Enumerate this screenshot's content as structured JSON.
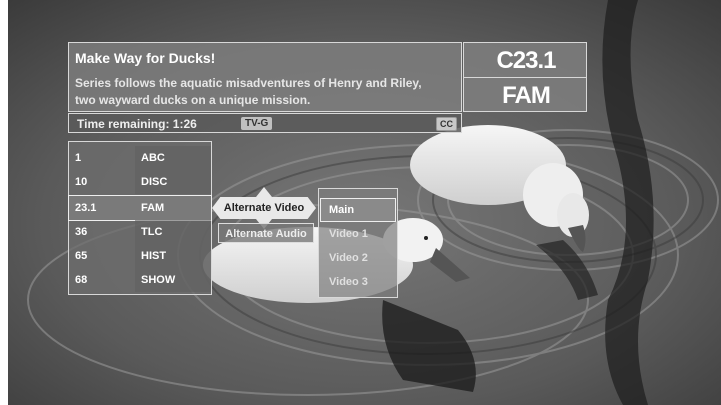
{
  "program": {
    "title": "Make Way for Ducks!",
    "description": "Series follows the aquatic misadventures of Henry and Riley, two wayward ducks on a unique mission.",
    "time_remaining": "Time remaining: 1:26",
    "rating": "TV-G",
    "cc": "CC"
  },
  "channel": {
    "number": "C23.1",
    "name": "FAM"
  },
  "channel_list": [
    {
      "number": "1",
      "name": "ABC"
    },
    {
      "number": "10",
      "name": "DISC"
    },
    {
      "number": "23.1",
      "name": "FAM",
      "selected": true
    },
    {
      "number": "36",
      "name": "TLC"
    },
    {
      "number": "65",
      "name": "HIST"
    },
    {
      "number": "68",
      "name": "SHOW"
    }
  ],
  "submenu": {
    "alternate_video": "Alternate Video",
    "alternate_audio": "Alternate Audio"
  },
  "video_options": [
    "Main",
    "Video 1",
    "Video 2",
    "Video 3"
  ],
  "selected_video": "Main",
  "colors": {
    "panel": "#808080",
    "highlight": "#e9e9e9"
  }
}
